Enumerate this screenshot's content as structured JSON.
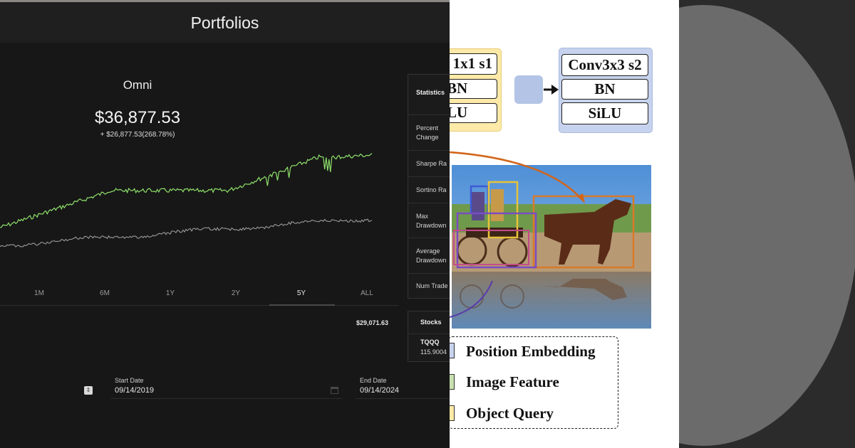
{
  "app": {
    "title": "Portfolios",
    "portfolio": {
      "name": "Omni",
      "value": "$36,877.53",
      "change": "+ $26,877.53(268.78%)"
    },
    "chart_data": {
      "type": "line",
      "series_colors": [
        "#8ee06a",
        "#9a9a9a"
      ],
      "range_selected": "5Y"
    },
    "ranges": [
      "1M",
      "6M",
      "1Y",
      "2Y",
      "5Y",
      "ALL"
    ],
    "active_range": "5Y",
    "secondary_amount": "$29,071.63",
    "start_date": {
      "label": "Start Date",
      "value": "09/14/2019"
    },
    "end_date": {
      "label": "End Date",
      "value": "09/14/2024"
    },
    "stats": {
      "heading": "Statistics",
      "rows": [
        {
          "label_lines": [
            "Percent",
            "Change"
          ]
        },
        {
          "label_lines": [
            "Sharpe Ra"
          ]
        },
        {
          "label_lines": [
            "Sortino Ra"
          ]
        },
        {
          "label_lines": [
            "Max",
            "Drawdown"
          ]
        },
        {
          "label_lines": [
            "Average",
            "Drawdown"
          ]
        },
        {
          "label_lines": [
            "Num Trade"
          ]
        }
      ]
    },
    "stocks": {
      "heading": "Stocks",
      "items": [
        {
          "ticker": "TQQQ",
          "quantity": "115.9004"
        }
      ]
    },
    "icons": [
      "stepper-icon",
      "calendar-icon"
    ],
    "colors": {
      "background": "#171717",
      "gain_line": "#8ee06a",
      "benchmark_line": "#9a9a9a"
    }
  },
  "figure": {
    "block1": {
      "line1": "1x1 s1",
      "line2": "BN",
      "line3": "LU"
    },
    "block2": {
      "line1": "Conv3x3 s2",
      "line2": "BN",
      "line3": "SiLU"
    },
    "legend": [
      "Position Embedding",
      "Image Feature",
      "Object Query"
    ],
    "colors": {
      "yellow_block": "#fdeaa8",
      "blue_block": "#c7d3ee",
      "arrow_orange": "#d2651a",
      "arrow_purple": "#5b3aa8"
    }
  }
}
